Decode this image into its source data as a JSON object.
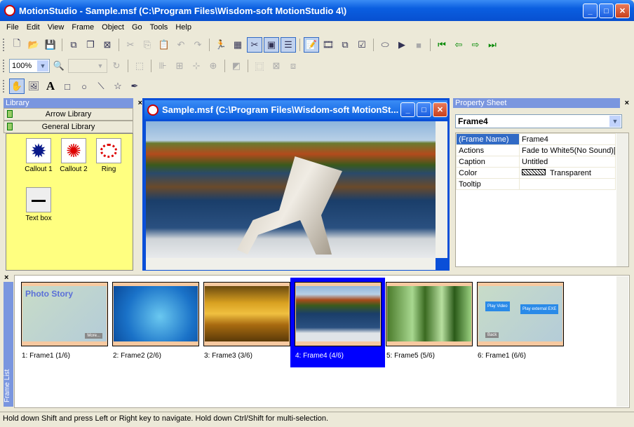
{
  "window": {
    "title": "MotionStudio - Sample.msf (C:\\Program Files\\Wisdom-soft MotionStudio 4\\)"
  },
  "menu": [
    "File",
    "Edit",
    "View",
    "Frame",
    "Object",
    "Go",
    "Tools",
    "Help"
  ],
  "toolbar": {
    "zoom": "100%"
  },
  "library": {
    "title": "Library",
    "groups": [
      "Arrow Library",
      "General Library"
    ],
    "items": [
      {
        "label": "Callout 1",
        "icon": "callout-burst-icon"
      },
      {
        "label": "Callout 2",
        "icon": "callout-red-icon"
      },
      {
        "label": "Ring",
        "icon": "ring-icon"
      },
      {
        "label": "Text box",
        "icon": "textbox-icon"
      }
    ],
    "bg": "#ffff80"
  },
  "document": {
    "title": "Sample.msf (C:\\Program Files\\Wisdom-soft MotionSt..."
  },
  "property_sheet": {
    "title": "Property Sheet",
    "selected": "Frame4",
    "rows": [
      {
        "name": "(Frame Name)",
        "value": "Frame4"
      },
      {
        "name": "Actions",
        "value": "Fade to White5(No Sound)["
      },
      {
        "name": "Caption",
        "value": "Untitled"
      },
      {
        "name": "Color",
        "value": "Transparent"
      },
      {
        "name": "Tooltip",
        "value": ""
      }
    ]
  },
  "frame_list": {
    "title": "Frame List",
    "frames": [
      {
        "label": "1: Frame1 (1/6)",
        "texts": [
          "Photo Story",
          "More..."
        ]
      },
      {
        "label": "2: Frame2 (2/6)"
      },
      {
        "label": "3: Frame3 (3/6)"
      },
      {
        "label": "4: Frame4 (4/6)",
        "selected": true
      },
      {
        "label": "5: Frame5 (5/6)"
      },
      {
        "label": "6: Frame1 (6/6)",
        "texts": [
          "Play Video",
          "Play external EXE",
          "Back"
        ]
      }
    ],
    "selection_color": "#0000ff"
  },
  "status": "Hold down Shift and press Left or Right key to navigate. Hold down Ctrl/Shift for multi-selection."
}
